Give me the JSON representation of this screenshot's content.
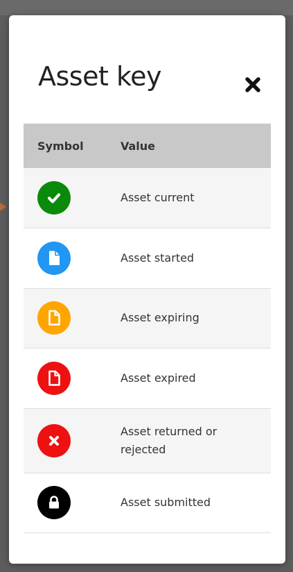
{
  "modal": {
    "title": "Asset key",
    "close_icon": "close-icon"
  },
  "table": {
    "headers": {
      "symbol": "Symbol",
      "value": "Value"
    },
    "rows": [
      {
        "icon": "check-icon",
        "color": "#0a8a0a",
        "value": "Asset current"
      },
      {
        "icon": "document-icon",
        "color": "#2196f3",
        "value": "Asset started"
      },
      {
        "icon": "document-icon",
        "color": "#ffa500",
        "value": "Asset expiring"
      },
      {
        "icon": "document-icon",
        "color": "#ee1111",
        "value": "Asset expired"
      },
      {
        "icon": "x-icon",
        "color": "#ee1111",
        "value": "Asset returned or rejected"
      },
      {
        "icon": "lock-icon",
        "color": "#000000",
        "value": "Asset submitted"
      }
    ]
  }
}
